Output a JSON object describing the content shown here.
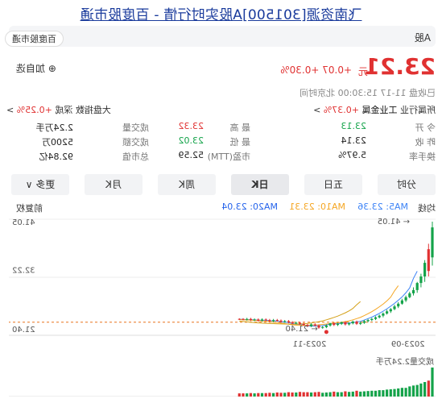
{
  "header": {
    "title": "飞南资源[301500]A股实时行情 - 百度股市通"
  },
  "top_bar": {
    "market_tab": "A股",
    "pill_1": "百度股市通",
    "pill_2": ""
  },
  "quote": {
    "price": "23.21",
    "unit": "元",
    "change": "+0.07 +0.30%",
    "watch_label": "⊕ 加自选",
    "status": "已收盘 11-17 15:30:00 北京时间"
  },
  "sector": {
    "label": "所属行业",
    "name": "工业金属",
    "change": "+0.37%",
    "chevron": ">"
  },
  "index": {
    "label": "大盘指数",
    "name": "深成",
    "change": "+0.25%",
    "chevron": ">"
  },
  "stats": [
    {
      "l1": "今 开",
      "v1": "23.13",
      "l2": "最 高",
      "v2": "23.32",
      "l3": "成交量",
      "v3": "2.24万手"
    },
    {
      "l1": "昨 收",
      "v1": "23.14",
      "l2": "最 低",
      "v2": "23.02",
      "l3": "成交额",
      "v3": "5200万"
    },
    {
      "l1": "换手率",
      "v1": "5.97%",
      "l2": "市盈(TTM)",
      "v2": "52.59",
      "l3": "总市值",
      "v3": "92.84亿"
    }
  ],
  "tabs": [
    "分时",
    "五日",
    "日K",
    "周K",
    "月K",
    "更多"
  ],
  "tab_more_chevron": "∨",
  "legend": {
    "period": "均线",
    "ma5": "MA5: 23.36",
    "ma10": "MA10: 23.31",
    "ma20": "MA20: 23.04",
    "adjust": "前复权"
  },
  "chart_data": {
    "type": "candlestick",
    "y_labels": [
      "41.05",
      "32.22",
      "21.40"
    ],
    "x_labels": [
      "2023-09",
      "2023-11"
    ],
    "high_marker": "41.05",
    "low_marker": "21.40",
    "last_close": "23.21",
    "volume_label": "成交量2.24万手",
    "colors": {
      "up": "#e03131",
      "down": "#14a34a",
      "ma5": "#3b82f6",
      "ma10": "#f5a623",
      "ma20": "#d4a017",
      "base": "#e8741b"
    },
    "candles": [
      {
        "o": 40.0,
        "c": 34.5,
        "h": 41.05,
        "l": 33.0,
        "up": false
      },
      {
        "o": 32.0,
        "c": 36.0,
        "h": 37.0,
        "l": 31.0,
        "up": true
      },
      {
        "o": 33.5,
        "c": 31.0,
        "h": 34.0,
        "l": 30.0,
        "up": false
      },
      {
        "o": 31.0,
        "c": 29.8,
        "h": 31.5,
        "l": 29.0,
        "up": false
      },
      {
        "o": 29.8,
        "c": 28.5,
        "h": 30.0,
        "l": 28.0,
        "up": false
      },
      {
        "o": 28.5,
        "c": 27.9,
        "h": 29.0,
        "l": 27.5,
        "up": false
      },
      {
        "o": 27.9,
        "c": 27.2,
        "h": 28.2,
        "l": 27.0,
        "up": false
      },
      {
        "o": 27.2,
        "c": 26.6,
        "h": 27.5,
        "l": 26.3,
        "up": false
      },
      {
        "o": 26.6,
        "c": 26.0,
        "h": 26.9,
        "l": 25.8,
        "up": false
      },
      {
        "o": 26.0,
        "c": 25.5,
        "h": 26.3,
        "l": 25.2,
        "up": false
      },
      {
        "o": 25.5,
        "c": 25.0,
        "h": 25.8,
        "l": 24.8,
        "up": false
      },
      {
        "o": 25.0,
        "c": 24.6,
        "h": 25.2,
        "l": 24.3,
        "up": false
      },
      {
        "o": 24.6,
        "c": 24.2,
        "h": 24.9,
        "l": 24.0,
        "up": false
      },
      {
        "o": 24.2,
        "c": 23.8,
        "h": 24.4,
        "l": 23.5,
        "up": false
      },
      {
        "o": 23.8,
        "c": 23.5,
        "h": 24.0,
        "l": 23.3,
        "up": false
      },
      {
        "o": 23.5,
        "c": 23.2,
        "h": 23.7,
        "l": 23.0,
        "up": false
      },
      {
        "o": 23.2,
        "c": 23.0,
        "h": 23.4,
        "l": 22.8,
        "up": false
      },
      {
        "o": 23.0,
        "c": 22.8,
        "h": 23.2,
        "l": 22.6,
        "up": false
      },
      {
        "o": 22.8,
        "c": 22.5,
        "h": 23.0,
        "l": 22.3,
        "up": false
      },
      {
        "o": 22.5,
        "c": 22.3,
        "h": 22.7,
        "l": 22.1,
        "up": false
      },
      {
        "o": 22.3,
        "c": 22.7,
        "h": 22.9,
        "l": 22.1,
        "up": true
      },
      {
        "o": 22.7,
        "c": 22.4,
        "h": 22.9,
        "l": 22.2,
        "up": false
      },
      {
        "o": 22.4,
        "c": 22.2,
        "h": 22.6,
        "l": 22.0,
        "up": false
      },
      {
        "o": 22.2,
        "c": 22.6,
        "h": 22.8,
        "l": 22.0,
        "up": true
      },
      {
        "o": 22.6,
        "c": 22.3,
        "h": 22.7,
        "l": 22.1,
        "up": false
      },
      {
        "o": 22.3,
        "c": 22.1,
        "h": 22.5,
        "l": 21.9,
        "up": false
      },
      {
        "o": 22.1,
        "c": 22.4,
        "h": 22.6,
        "l": 21.9,
        "up": true
      },
      {
        "o": 22.4,
        "c": 22.0,
        "h": 22.5,
        "l": 21.8,
        "up": false
      },
      {
        "o": 22.0,
        "c": 21.7,
        "h": 22.2,
        "l": 21.5,
        "up": false
      },
      {
        "o": 21.7,
        "c": 21.6,
        "h": 21.9,
        "l": 21.4,
        "up": false
      },
      {
        "o": 21.6,
        "c": 22.0,
        "h": 22.2,
        "l": 21.4,
        "up": true
      },
      {
        "o": 22.0,
        "c": 22.2,
        "h": 22.4,
        "l": 21.8,
        "up": true
      },
      {
        "o": 22.2,
        "c": 21.9,
        "h": 22.4,
        "l": 21.7,
        "up": false
      },
      {
        "o": 21.9,
        "c": 22.1,
        "h": 22.3,
        "l": 21.7,
        "up": true
      },
      {
        "o": 22.1,
        "c": 22.3,
        "h": 22.5,
        "l": 21.9,
        "up": true
      },
      {
        "o": 22.3,
        "c": 22.5,
        "h": 22.7,
        "l": 22.1,
        "up": true
      },
      {
        "o": 22.5,
        "c": 22.4,
        "h": 22.7,
        "l": 22.2,
        "up": false
      },
      {
        "o": 22.4,
        "c": 22.6,
        "h": 22.8,
        "l": 22.2,
        "up": true
      },
      {
        "o": 22.6,
        "c": 22.8,
        "h": 23.0,
        "l": 22.4,
        "up": true
      },
      {
        "o": 22.8,
        "c": 22.7,
        "h": 23.0,
        "l": 22.5,
        "up": false
      },
      {
        "o": 22.7,
        "c": 22.9,
        "h": 23.1,
        "l": 22.5,
        "up": true
      },
      {
        "o": 22.9,
        "c": 23.0,
        "h": 23.2,
        "l": 22.7,
        "up": true
      },
      {
        "o": 23.0,
        "c": 22.8,
        "h": 23.2,
        "l": 22.6,
        "up": false
      },
      {
        "o": 22.8,
        "c": 23.0,
        "h": 23.2,
        "l": 22.6,
        "up": true
      },
      {
        "o": 23.0,
        "c": 23.1,
        "h": 23.3,
        "l": 22.8,
        "up": true
      },
      {
        "o": 23.1,
        "c": 22.9,
        "h": 23.3,
        "l": 22.7,
        "up": false
      },
      {
        "o": 22.9,
        "c": 23.1,
        "h": 23.3,
        "l": 22.7,
        "up": true
      },
      {
        "o": 23.1,
        "c": 23.0,
        "h": 23.3,
        "l": 22.8,
        "up": false
      },
      {
        "o": 23.0,
        "c": 23.2,
        "h": 23.4,
        "l": 22.8,
        "up": true
      },
      {
        "o": 23.2,
        "c": 23.1,
        "h": 23.4,
        "l": 22.9,
        "up": false
      },
      {
        "o": 23.1,
        "c": 23.2,
        "h": 23.35,
        "l": 22.95,
        "up": true
      },
      {
        "o": 23.13,
        "c": 23.21,
        "h": 23.32,
        "l": 23.02,
        "up": true
      }
    ],
    "volumes": [
      1.0,
      0.55,
      0.5,
      0.45,
      0.4,
      0.38,
      0.35,
      0.3,
      0.3,
      0.28,
      0.26,
      0.25,
      0.24,
      0.22,
      0.22,
      0.2,
      0.2,
      0.19,
      0.18,
      0.17,
      0.2,
      0.17,
      0.16,
      0.18,
      0.15,
      0.15,
      0.17,
      0.15,
      0.14,
      0.13,
      0.16,
      0.15,
      0.14,
      0.15,
      0.15,
      0.16,
      0.14,
      0.14,
      0.15,
      0.13,
      0.13,
      0.14,
      0.12,
      0.13,
      0.12,
      0.12,
      0.12,
      0.11,
      0.12,
      0.11,
      0.11,
      0.11
    ]
  }
}
